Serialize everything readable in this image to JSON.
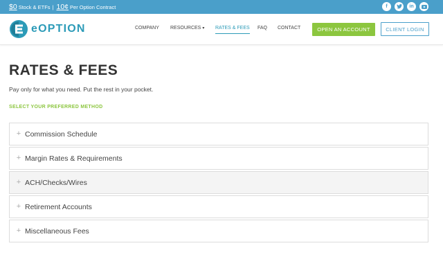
{
  "topbar": {
    "stock_price": "$0",
    "stock_text": "Stock & ETFs",
    "separator": "|",
    "option_price": "10¢",
    "option_text": "Per Option Contract",
    "social": [
      "f",
      "t",
      "in",
      "yt"
    ]
  },
  "header": {
    "logo_text": "eOPTION",
    "nav": {
      "company": "COMPANY",
      "resources": "RESOURCES",
      "rates": "RATES & FEES",
      "faq": "FAQ",
      "contact": "CONTACT"
    },
    "open_account": "OPEN AN ACCOUNT",
    "client_login": "CLIENT LOGIN"
  },
  "main": {
    "title": "RATES & FEES",
    "subtitle": "Pay only for what you need. Put the rest in your pocket.",
    "method_label": "SELECT YOUR PREFERRED METHOD",
    "accordion": [
      "Commission Schedule",
      "Margin Rates & Requirements",
      "ACH/Checks/Wires",
      "Retirement Accounts",
      "Miscellaneous Fees"
    ]
  },
  "colors": {
    "topbar_bg": "#4a9fca",
    "brand": "#2c9bb8",
    "green": "#8cc63f"
  }
}
